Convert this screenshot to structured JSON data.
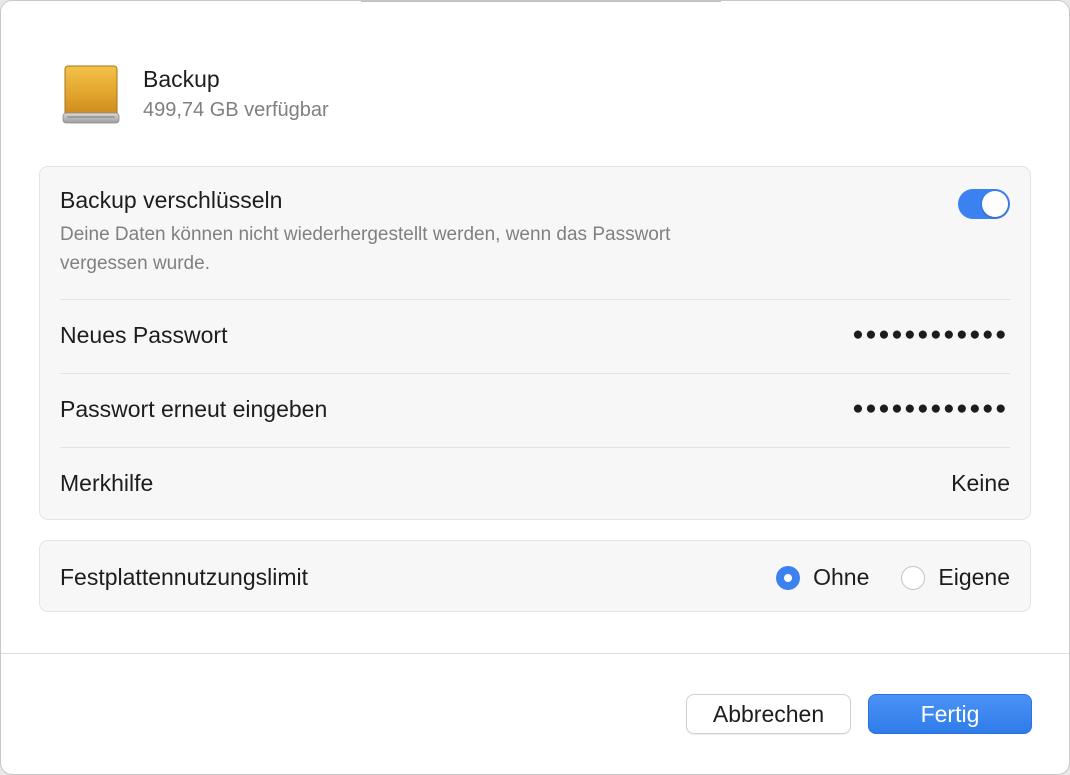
{
  "drive": {
    "icon": "external-drive-icon",
    "name": "Backup",
    "available": "499,74 GB verfügbar"
  },
  "encryption": {
    "title": "Backup verschlüsseln",
    "description_line1": "Deine Daten können nicht wiederhergestellt werden, wenn das Passwort",
    "description_line2": "vergessen wurde.",
    "enabled": true,
    "new_password_label": "Neues Passwort",
    "new_password_value": "●●●●●●●●●●●●",
    "confirm_password_label": "Passwort erneut eingeben",
    "confirm_password_value": "●●●●●●●●●●●●",
    "hint_label": "Merkhilfe",
    "hint_value": "Keine"
  },
  "disk_limit": {
    "label": "Festplattennutzungslimit",
    "options": [
      {
        "label": "Ohne",
        "selected": true
      },
      {
        "label": "Eigene",
        "selected": false
      }
    ]
  },
  "buttons": {
    "cancel": "Abbrechen",
    "done": "Fertig"
  },
  "colors": {
    "accent": "#3b82f0",
    "drive_icon": "#e0a52c"
  }
}
